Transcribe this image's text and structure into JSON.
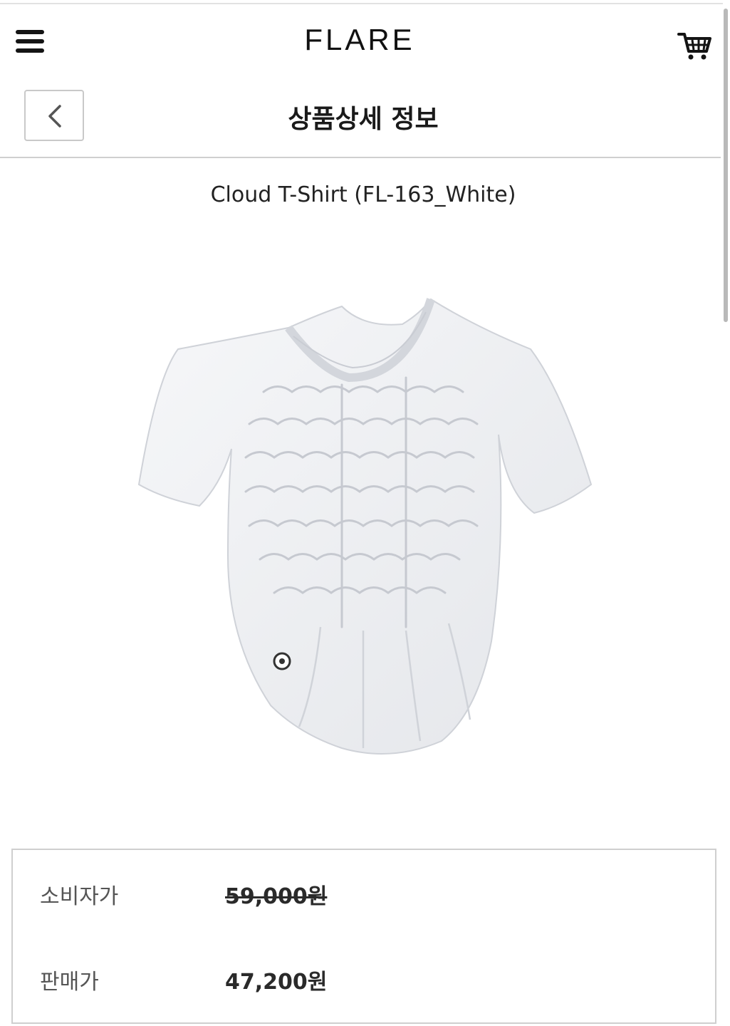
{
  "header": {
    "logo": "FLARE",
    "menu_icon": "hamburger-menu-icon",
    "cart_icon": "shopping-cart-icon"
  },
  "subheader": {
    "title": "상품상세 정보",
    "back_icon": "chevron-left-icon"
  },
  "product": {
    "name": "Cloud T-Shirt (FL-163_White)",
    "image": "white ruched t-shirt"
  },
  "pricing": {
    "retail_label": "소비자가",
    "retail_price": "59,000원",
    "sale_label": "판매가",
    "sale_price": "47,200원"
  },
  "colors": {
    "text": "#222222",
    "border": "#cfcfcf",
    "background": "#ffffff"
  }
}
